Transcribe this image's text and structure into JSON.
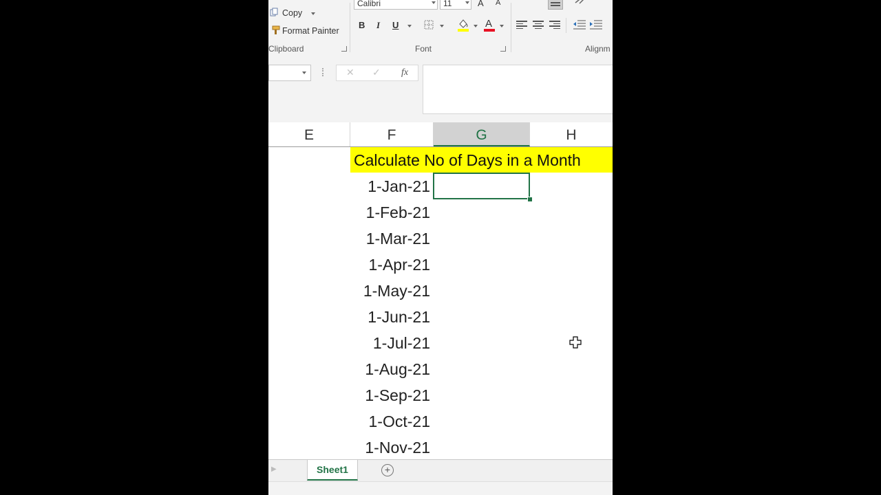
{
  "ribbon": {
    "clipboard": {
      "copy_label": "Copy",
      "format_painter_label": "Format Painter",
      "group_label": "Clipboard"
    },
    "font": {
      "font_name": "Calibri",
      "font_size": "11",
      "bold_label": "B",
      "italic_label": "I",
      "underline_label": "U",
      "font_color_label": "A",
      "group_label": "Font",
      "font_color": "#e81123",
      "fill_color": "#ffff00"
    },
    "alignment": {
      "group_label": "Alignm"
    }
  },
  "formula_bar": {
    "name_box_value": "",
    "formula_value": "",
    "cancel_symbol": "✕",
    "enter_symbol": "✓",
    "fx_label": "fx"
  },
  "columns": [
    "E",
    "F",
    "G",
    "H"
  ],
  "selected_column": "G",
  "sheet": {
    "title": "Calculate No of Days in a Month",
    "dates": [
      "1-Jan-21",
      "1-Feb-21",
      "1-Mar-21",
      "1-Apr-21",
      "1-May-21",
      "1-Jun-21",
      "1-Jul-21",
      "1-Aug-21",
      "1-Sep-21",
      "1-Oct-21",
      "1-Nov-21"
    ],
    "highlight_color": "#ffff00",
    "accent_color": "#217346"
  },
  "tabs": {
    "sheet_name": "Sheet1",
    "add_sheet_symbol": "+"
  }
}
